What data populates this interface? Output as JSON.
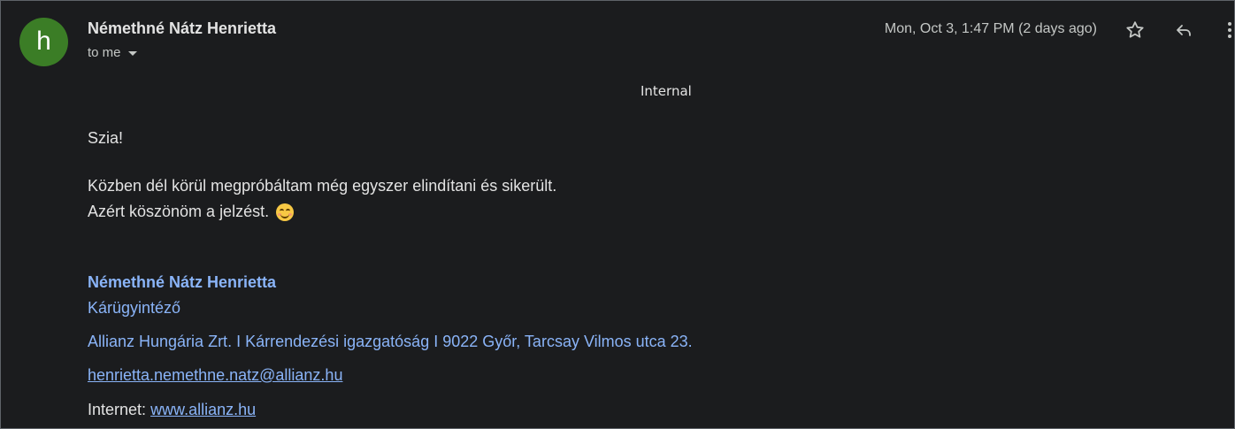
{
  "header": {
    "avatar_letter": "h",
    "sender_name": "Némethné Nátz Henrietta",
    "recipient": "to me",
    "datetime": "Mon, Oct 3, 1:47 PM (2 days ago)",
    "icons": {
      "star": "star-icon",
      "reply": "reply-icon",
      "more": "more-vert-icon"
    },
    "colors": {
      "avatar_bg": "#3b7d26",
      "link": "#8ab4f8"
    }
  },
  "classification": "Internal",
  "body": {
    "greeting": "Szia!",
    "line1": "Közben dél körül megpróbáltam még egyszer elindítani és sikerült.",
    "line2": "Azért köszönöm a jelzést.",
    "emoji": "smiling-face-emoji"
  },
  "signature": {
    "name": "Némethné Nátz Henrietta",
    "title": "Kárügyintéző",
    "address": "Allianz Hungária Zrt. I Kárrendezési igazgatóság I 9022 Győr, Tarcsay Vilmos utca 23.",
    "email": "henrietta.nemethne.natz@allianz.hu",
    "web_label": "Internet:",
    "web_link": "www.allianz.hu"
  }
}
